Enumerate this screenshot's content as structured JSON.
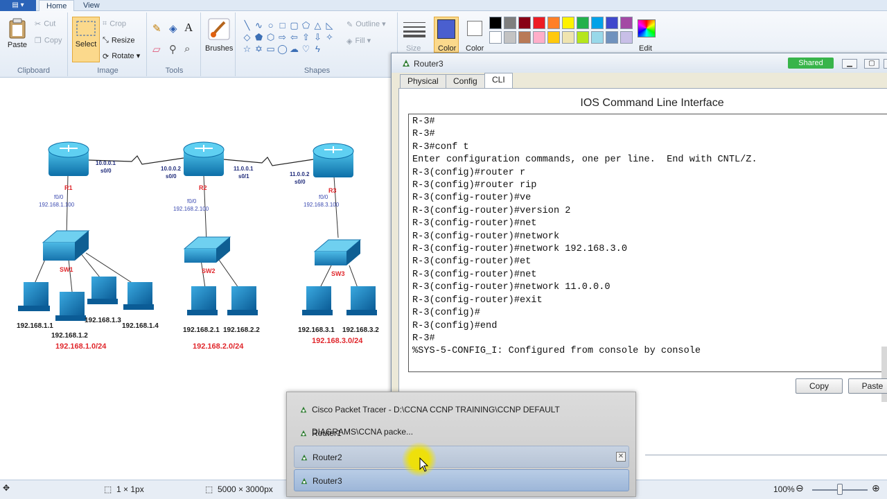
{
  "paint": {
    "tabs": [
      "Home",
      "View"
    ],
    "clipboard": {
      "paste": "Paste",
      "cut": "Cut",
      "copy": "Copy",
      "label": "Clipboard"
    },
    "image": {
      "select": "Select",
      "crop": "Crop",
      "resize": "Resize",
      "rotate": "Rotate",
      "label": "Image"
    },
    "tools": {
      "label": "Tools"
    },
    "brushes": {
      "label": "Brushes"
    },
    "shapes": {
      "outline": "Outline",
      "fill": "Fill",
      "label": "Shapes"
    },
    "size": {
      "label": "Size"
    },
    "colors": {
      "color1": "Color",
      "color2": "Color",
      "edit": "Edit",
      "palette_row1": [
        "#000000",
        "#7f7f7f",
        "#880015",
        "#ed1c24",
        "#ff7f27",
        "#fff200",
        "#22b14c",
        "#00a2e8",
        "#3f48cc",
        "#a349a4"
      ],
      "palette_row2": [
        "#ffffff",
        "#c3c3c3",
        "#b97a57",
        "#ffaec9",
        "#ffc90e",
        "#efe4b0",
        "#b5e61d",
        "#99d9ea",
        "#7092be",
        "#c8bfe7"
      ],
      "color1_value": "#4a5fcf"
    },
    "status": {
      "pixel_size": "1 × 1px",
      "canvas_size": "5000 × 3000px",
      "zoom": "100%"
    }
  },
  "topology": {
    "routers": [
      {
        "name": "R1",
        "serial_ip": "10.0.0.1",
        "serial_if": "s0/0",
        "fa_if": "f0/0",
        "fa_ip": "192.168.1.100"
      },
      {
        "name": "R2",
        "serial_ip": "10.0.0.2",
        "serial_if": "s0/0",
        "serial2_ip": "11.0.0.1",
        "serial2_if": "s0/1",
        "fa_if": "f0/0",
        "fa_ip": "192.168.2.100"
      },
      {
        "name": "R3",
        "serial_ip": "11.0.0.2",
        "serial_if": "s0/0",
        "fa_if": "f0/0",
        "fa_ip": "192.168.3.100"
      }
    ],
    "switches": [
      "SW1",
      "SW2",
      "SW3"
    ],
    "pcs": [
      "192.168.1.1",
      "192.168.1.2",
      "192.168.1.3",
      "192.168.1.4",
      "192.168.2.1",
      "192.168.2.2",
      "192.168.3.1",
      "192.168.3.2"
    ],
    "networks": [
      "192.168.1.0/24",
      "192.168.2.0/24",
      "192.168.3.0/24"
    ]
  },
  "router_window": {
    "title": "Router3",
    "shared_badge": "Shared",
    "tabs": [
      "Physical",
      "Config",
      "CLI"
    ],
    "active_tab": "CLI",
    "heading": "IOS Command Line Interface",
    "cli_lines": [
      "R-3#",
      "R-3#",
      "R-3#conf t",
      "Enter configuration commands, one per line.  End with CNTL/Z.",
      "R-3(config)#router r",
      "R-3(config)#router rip",
      "R-3(config-router)#ve",
      "R-3(config-router)#version 2",
      "R-3(config-router)#net",
      "R-3(config-router)#network",
      "R-3(config-router)#network 192.168.3.0",
      "R-3(config-router)#et",
      "R-3(config-router)#net",
      "R-3(config-router)#network 11.0.0.0",
      "R-3(config-router)#exit",
      "R-3(config)#",
      "R-3(config)#end",
      "R-3#",
      "%SYS-5-CONFIG_I: Configured from console by console"
    ],
    "copy_button": "Copy",
    "paste_button": "Paste"
  },
  "taskbar_popup": {
    "items": [
      "Cisco Packet Tracer - D:\\CCNA CCNP TRAINING\\CCNP DEFAULT DIAGRAMS\\CCNA packe...",
      "Router1",
      "Router2",
      "Router3"
    ],
    "hovered": "Router2",
    "selected": "Router3"
  }
}
